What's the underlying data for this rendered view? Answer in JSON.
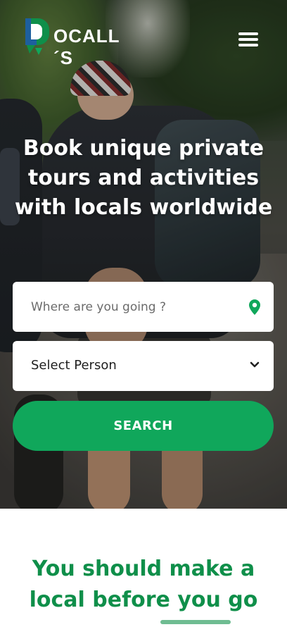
{
  "brand": {
    "name": "OCALL´S",
    "accent_color": "#10a75b",
    "logo_icon": "map-pin-logo-icon"
  },
  "header": {
    "menu_icon": "hamburger-menu-icon"
  },
  "hero": {
    "headline": "Book unique private tours and activities with locals worldwide"
  },
  "search": {
    "destination_placeholder": "Where are you going ?",
    "destination_icon": "location-pin-icon",
    "person_select_value": "Select Person",
    "person_select_icon": "chevron-down-icon",
    "button_label": "SEARCH"
  },
  "section": {
    "title": "You should make a local before you go"
  }
}
